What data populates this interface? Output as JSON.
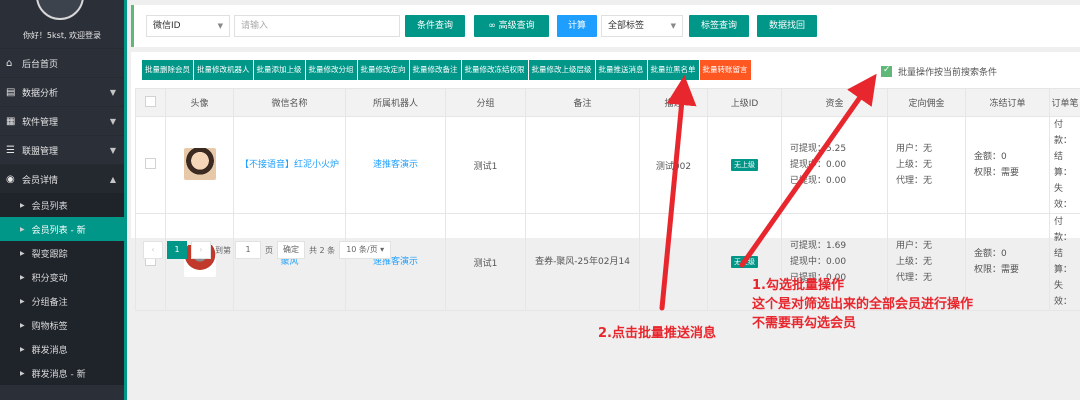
{
  "sidebar": {
    "greeting": "你好！5kst, 欢迎登录",
    "menu": [
      {
        "label": "后台首页",
        "icon": "⌂",
        "caret": ""
      },
      {
        "label": "数据分析",
        "icon": "▤",
        "caret": "▼"
      },
      {
        "label": "软件管理",
        "icon": "▦",
        "caret": "▼"
      },
      {
        "label": "联盟管理",
        "icon": "☰",
        "caret": "▼"
      },
      {
        "label": "会员详情",
        "icon": "◉",
        "caret": "▲"
      }
    ],
    "submenu": [
      {
        "label": "会员列表"
      },
      {
        "label": "会员列表 - 新"
      },
      {
        "label": "裂变跟踪"
      },
      {
        "label": "积分变动"
      },
      {
        "label": "分组备注"
      },
      {
        "label": "购物标签"
      },
      {
        "label": "群发消息"
      },
      {
        "label": "群发消息 - 新"
      }
    ]
  },
  "search": {
    "field_select": "微信ID",
    "input_placeholder": "请输入",
    "btn_query": "条件查询",
    "btn_advanced": "高级查询",
    "btn_calc": "计算",
    "tag_select": "全部标签",
    "btn_tag_query": "标签查询",
    "btn_recover": "数据找回"
  },
  "batch": {
    "buttons": [
      "批量删除会员",
      "批量修改机器人",
      "批量添加上级",
      "批量修改分组",
      "批量修改定向",
      "批量修改备注",
      "批量修改冻结权限",
      "批量修改上级层级",
      "批量推送消息",
      "批量拉黑名单",
      "批量转账留言"
    ],
    "checkbox_label": "批量操作按当前搜索条件"
  },
  "table": {
    "headers": [
      "头像",
      "微信名称",
      "所属机器人",
      "分组",
      "备注",
      "描述",
      "上级ID",
      "资金",
      "定向佣金",
      "冻结订单",
      "订单笔"
    ],
    "rows": [
      {
        "name": "【不接语音】红泥小火炉",
        "robot": "速推客演示",
        "group": "测试1",
        "remark": "",
        "desc": "测试002",
        "parent": "无上级",
        "fund": [
          "可提现：5.25",
          "提现中：0.00",
          "已提现：0.00"
        ],
        "commission": [
          "用户：无",
          "上级：无",
          "代理：无"
        ],
        "frozen": [
          "金额：0",
          "权限：需要"
        ],
        "orders": [
          "付款：",
          "结算：",
          "失效："
        ]
      },
      {
        "name": "聚风",
        "robot": "速推客演示",
        "group": "测试1",
        "remark": "查券-聚风-25年02月14",
        "desc": "",
        "parent": "无上级",
        "fund": [
          "可提现：1.69",
          "提现中：0.00",
          "已提现：0.00"
        ],
        "commission": [
          "用户：无",
          "上级：无",
          "代理：无"
        ],
        "frozen": [
          "金额：0",
          "权限：需要"
        ],
        "orders": [
          "付款：",
          "结算：",
          "失效："
        ]
      }
    ]
  },
  "pager": {
    "prev": "‹",
    "current": "1",
    "next": "›",
    "goto": "到第",
    "page_value": "1",
    "page_unit": "页",
    "confirm": "确定",
    "total": "共 2 条",
    "page_size": "10 条/页"
  },
  "annotations": {
    "note1_line1": "1.勾选批量操作",
    "note1_line2": "这个是对筛选出来的全部会员进行操作",
    "note1_line3": "不需要再勾选会员",
    "note2": "2.点击批量推送消息"
  },
  "colors": {
    "accent": "#009688",
    "blue": "#1e9fff",
    "annotation": "#e8262d",
    "sidebar": "#2b2f38"
  }
}
